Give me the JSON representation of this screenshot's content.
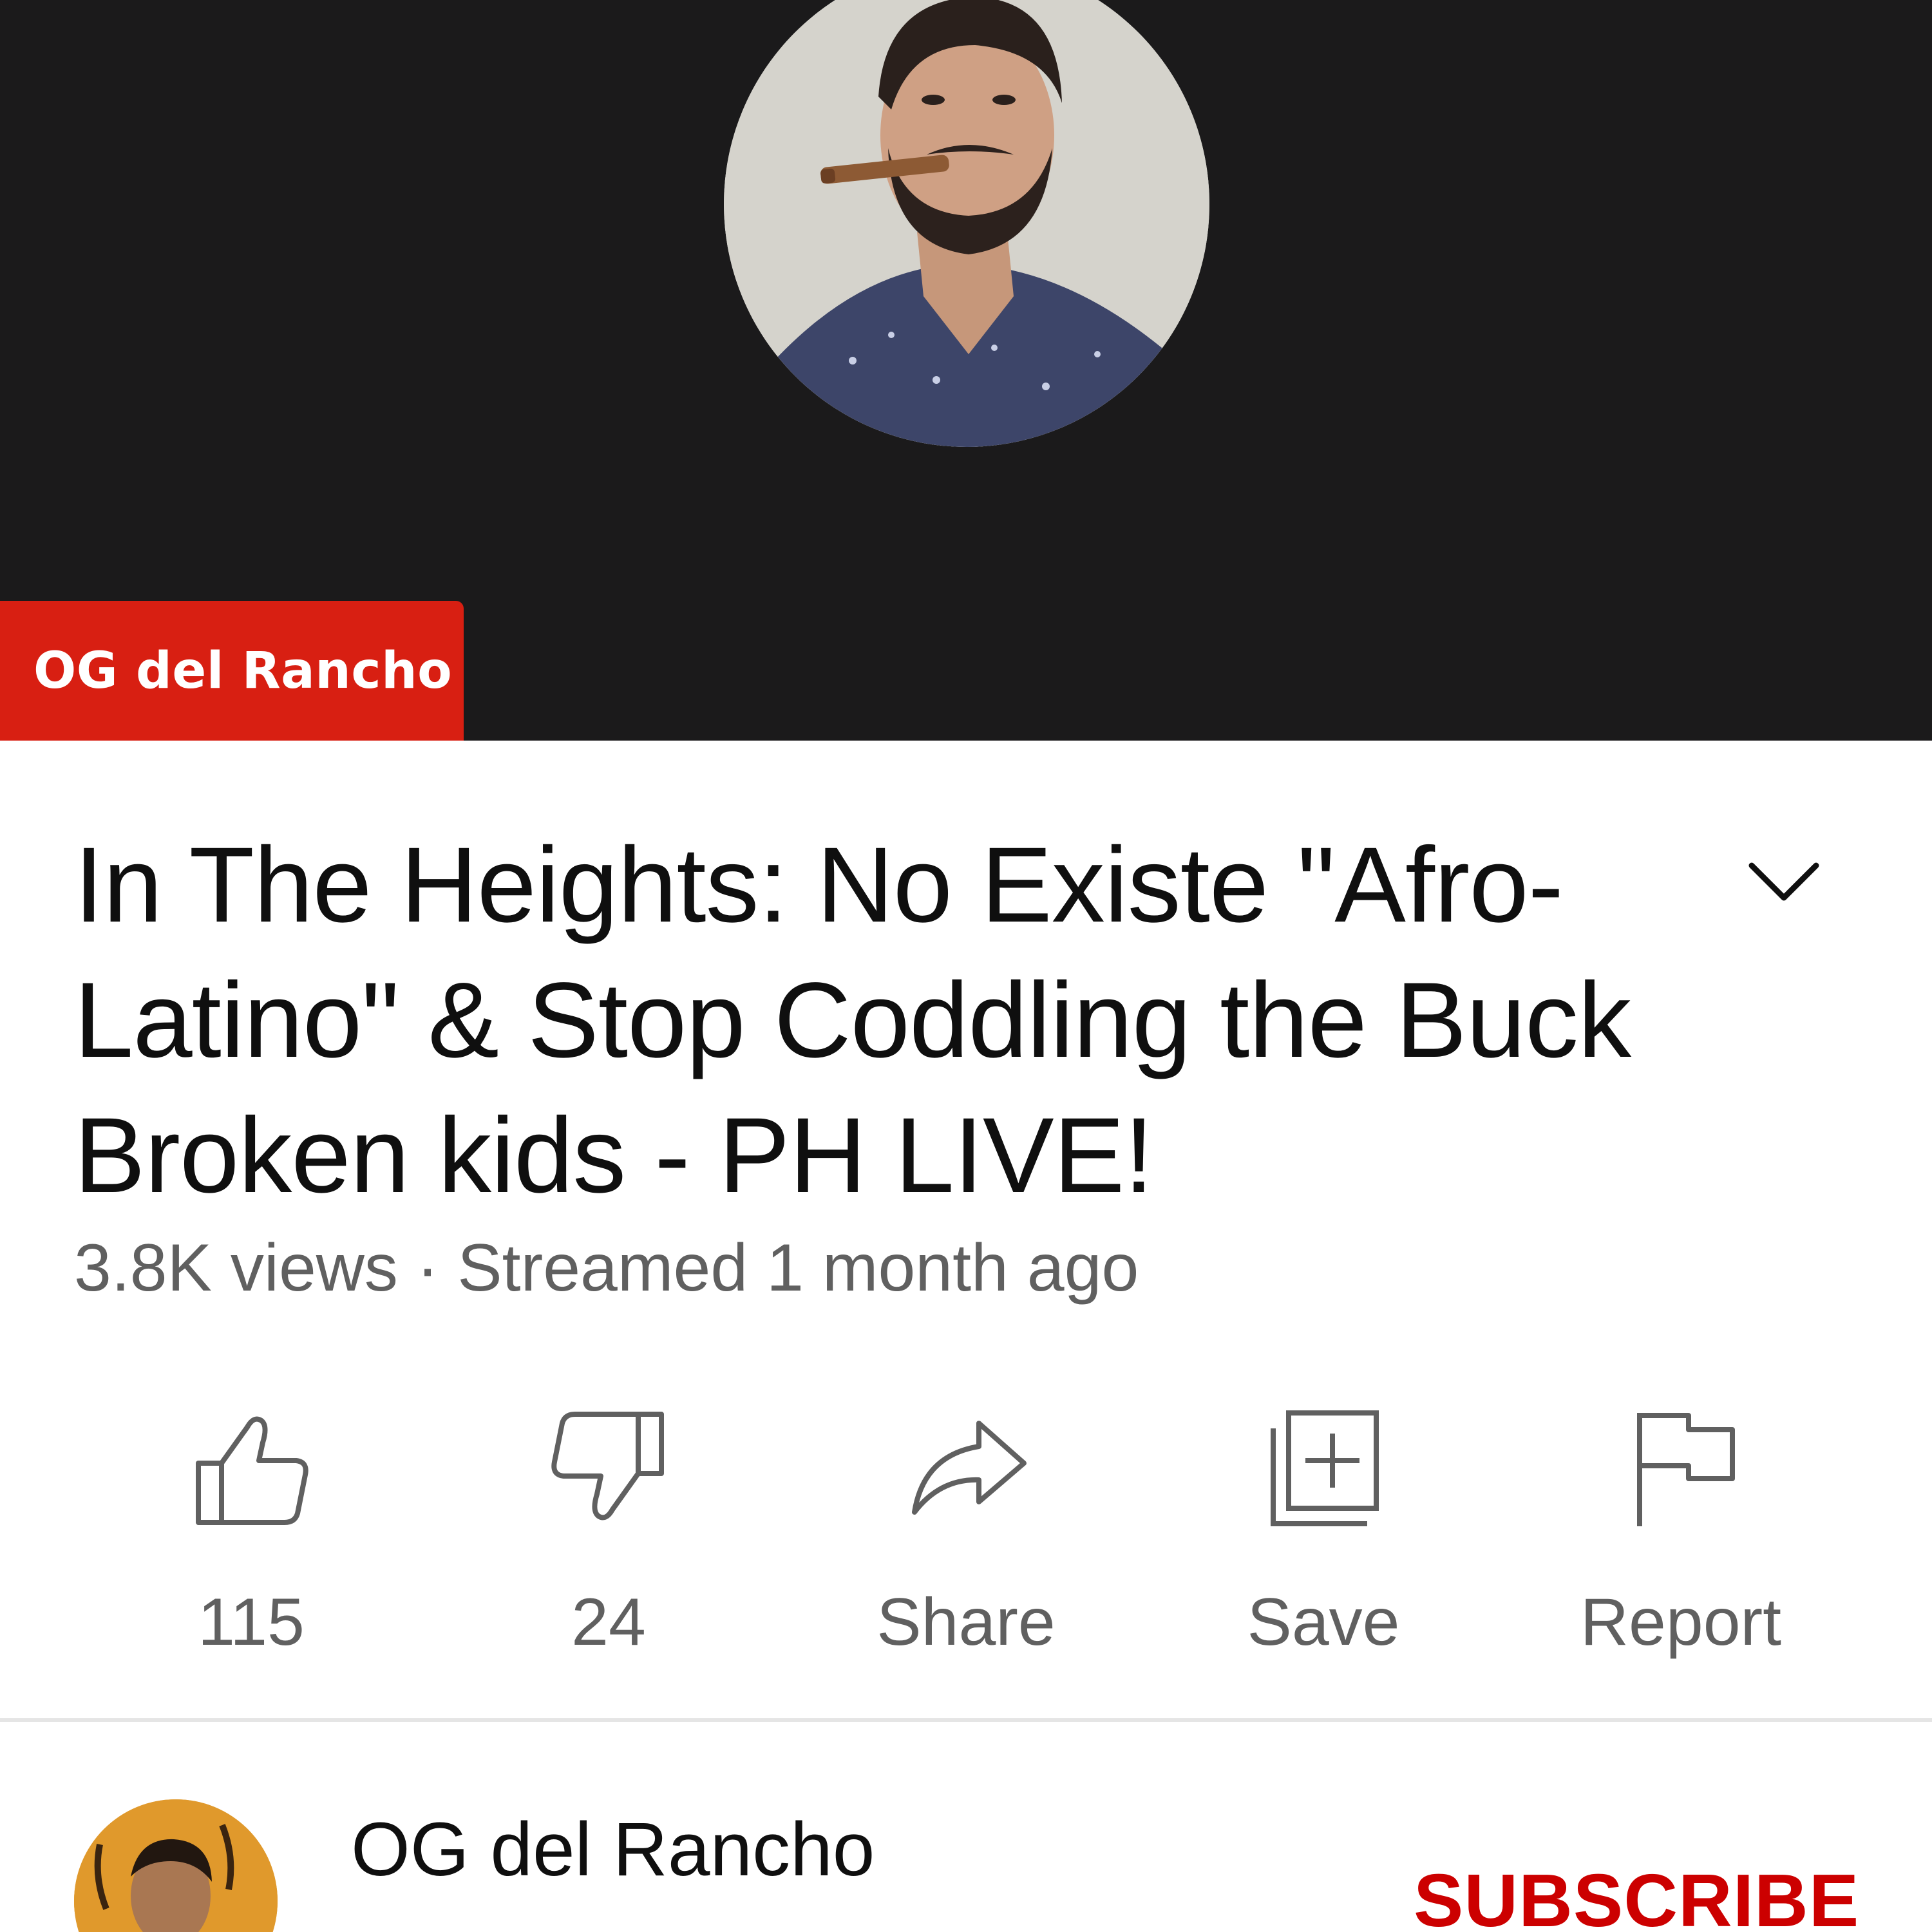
{
  "video": {
    "channel_tag": "OG del Rancho",
    "title": "In The Heights: No Existe \"Afro-Latino\" & Stop Coddling the Buck Broken kids - PH LIVE!",
    "meta": "3.8K views · Streamed 1 month ago"
  },
  "actions": {
    "like_count": "115",
    "dislike_count": "24",
    "share_label": "Share",
    "save_label": "Save",
    "report_label": "Report"
  },
  "channel": {
    "name": "OG del Rancho",
    "subscribe_label": "SUBSCRIBE"
  },
  "colors": {
    "player_background": "#1b1a1b",
    "channel_tag": "#d81f12",
    "subscribe": "#cc0000",
    "secondary_text": "#606060"
  },
  "icons": [
    "like-icon",
    "dislike-icon",
    "share-icon",
    "save-icon",
    "report-icon",
    "chevron-down-icon"
  ]
}
